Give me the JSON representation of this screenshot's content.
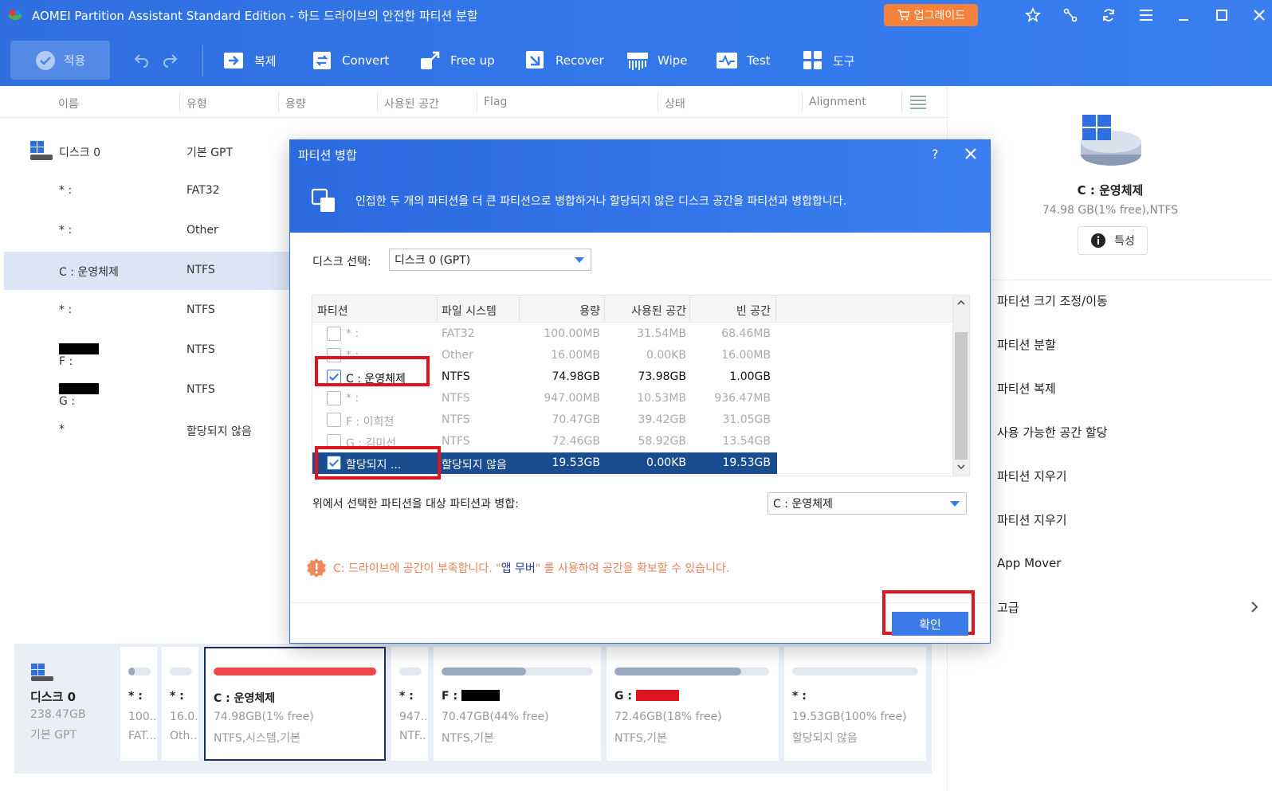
{
  "app": {
    "title": "AOMEI Partition Assistant Standard Edition - 하드 드라이브의 안전한 파티션 분할",
    "upgrade": "업그레이드"
  },
  "toolbar": {
    "apply": "적용",
    "items": [
      {
        "label": "복제",
        "icon": "copy-icon"
      },
      {
        "label": "Convert",
        "icon": "convert-icon"
      },
      {
        "label": "Free up",
        "icon": "free-up-icon"
      },
      {
        "label": "Recover",
        "icon": "recover-icon"
      },
      {
        "label": "Wipe",
        "icon": "wipe-icon"
      },
      {
        "label": "Test",
        "icon": "test-icon"
      },
      {
        "label": "도구",
        "icon": "tools-icon"
      }
    ]
  },
  "columns": [
    "이름",
    "유형",
    "용량",
    "사용된 공간",
    "Flag",
    "상태",
    "Alignment"
  ],
  "disk_list": [
    {
      "name": "디스크 0",
      "type": "기본 GPT"
    },
    {
      "name": "* :",
      "type": "FAT32"
    },
    {
      "name": "* :",
      "type": "Other"
    },
    {
      "name": "C : 운영체제",
      "type": "NTFS"
    },
    {
      "name": "* :",
      "type": "NTFS"
    },
    {
      "name": "F :",
      "type": "NTFS"
    },
    {
      "name": "G :",
      "type": "NTFS"
    },
    {
      "name": "*",
      "type": "할당되지 않음"
    }
  ],
  "right_panel": {
    "title": "C : 운영체제",
    "subtitle": "74.98 GB(1% free),NTFS",
    "properties": "특성",
    "actions": [
      "파티션 크기 조정/이동",
      "파티션 분할",
      "파티션 복제",
      "사용 가능한 공간 할당",
      "파티션 지우기",
      "파티션 지우기",
      "App Mover",
      "고급"
    ]
  },
  "disk_map": {
    "disk": {
      "name": "디스크 0",
      "size": "238.47GB",
      "type": "기본 GPT"
    },
    "cells": [
      {
        "name": "* :",
        "l1": "100....",
        "l2": "FAT...",
        "fill": 0.3
      },
      {
        "name": "* :",
        "l1": "16.0...",
        "l2": "Oth...",
        "fill": 0.0
      },
      {
        "name": "C : 운영체제",
        "l1": "74.98GB(1% free)",
        "l2": "NTFS,시스템,기본",
        "fill": 0.99
      },
      {
        "name": "* :",
        "l1": "947....",
        "l2": "NTF...",
        "fill": 0.0
      },
      {
        "name": "F :",
        "l1": "70.47GB(44% free)",
        "l2": "NTFS,기본",
        "fill": 0.56
      },
      {
        "name": "G :",
        "l1": "72.46GB(18% free)",
        "l2": "NTFS,기본",
        "fill": 0.82
      },
      {
        "name": "* :",
        "l1": "19.53GB(100% free)",
        "l2": "할당되지 않음",
        "fill": 0.0
      }
    ]
  },
  "dialog": {
    "title": "파티션 병합",
    "help": "?",
    "description": "인접한 두 개의 파티션을 더 큰 파티션으로 병합하거나 할당되지 않은 디스크 공간을 파티션과 병합합니다.",
    "disk_select_label": "디스크 선택:",
    "disk_select_value": "디스크 0 (GPT)",
    "table_headers": [
      "파티션",
      "파일 시스템",
      "용량",
      "사용된 공간",
      "빈 공간"
    ],
    "rows": [
      {
        "partition": "* :",
        "fs": "FAT32",
        "capacity": "100.00MB",
        "used": "31.54MB",
        "free": "68.46MB",
        "checked": false
      },
      {
        "partition": "* :",
        "fs": "Other",
        "capacity": "16.00MB",
        "used": "0.00KB",
        "free": "16.00MB",
        "checked": false
      },
      {
        "partition": "C :  운영체제",
        "fs": "NTFS",
        "capacity": "74.98GB",
        "used": "73.98GB",
        "free": "1.00GB",
        "checked": true
      },
      {
        "partition": "* :",
        "fs": "NTFS",
        "capacity": "947.00MB",
        "used": "10.53MB",
        "free": "936.47MB",
        "checked": false
      },
      {
        "partition": "F :  이희천",
        "fs": "NTFS",
        "capacity": "70.47GB",
        "used": "39.42GB",
        "free": "31.05GB",
        "checked": false
      },
      {
        "partition": "G :  김미선",
        "fs": "NTFS",
        "capacity": "72.46GB",
        "used": "58.92GB",
        "free": "13.54GB",
        "checked": false
      },
      {
        "partition": "할당되지 ...",
        "fs": "할당되지 않음",
        "capacity": "19.53GB",
        "used": "0.00KB",
        "free": "19.53GB",
        "checked": true
      }
    ],
    "merge_label": "위에서 선택한 파티션을 대상 파티션과 병합:",
    "merge_target": "C :  운영체제",
    "warning_pre": "C: 드라이브에 공간이 부족합니다. \"",
    "warning_link": "앱 무버",
    "warning_post": "\" 를 사용하여 공간을 확보할 수 있습니다.",
    "ok": "확인"
  },
  "colors": {
    "accent": "#3a7be8",
    "header": "#2f6fe0",
    "highlight_row": "#1a4d8f",
    "annotation": "#e0141e",
    "warning": "#e8835a",
    "c_bar": "#f04848"
  }
}
